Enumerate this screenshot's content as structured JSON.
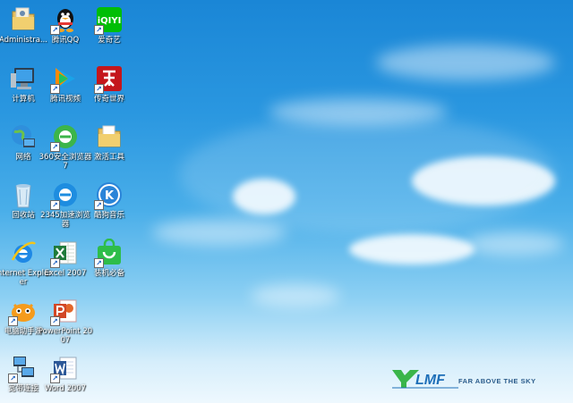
{
  "desktop": {
    "icons": [
      {
        "label": "Administra...",
        "icon": "folder-user-icon"
      },
      {
        "label": "腾讯QQ",
        "icon": "qq-penguin-icon"
      },
      {
        "label": "爱奇艺",
        "icon": "iqiyi-icon"
      },
      {
        "label": "计算机",
        "icon": "computer-icon"
      },
      {
        "label": "腾讯视频",
        "icon": "tencent-video-icon"
      },
      {
        "label": "传奇世界",
        "icon": "legend-world-icon"
      },
      {
        "label": "网络",
        "icon": "network-icon"
      },
      {
        "label": "360安全浏览器7",
        "icon": "360-browser-icon"
      },
      {
        "label": "激活工具",
        "icon": "folder-icon"
      },
      {
        "label": "回收站",
        "icon": "recycle-bin-icon"
      },
      {
        "label": "2345加速浏览器",
        "icon": "2345-browser-icon"
      },
      {
        "label": "酷狗音乐",
        "icon": "kugou-music-icon"
      },
      {
        "label": "Internet Explorer",
        "icon": "ie-icon"
      },
      {
        "label": "Excel 2007",
        "icon": "excel-icon"
      },
      {
        "label": "装机必备",
        "icon": "shopping-bag-icon"
      },
      {
        "label": "电脑助手游",
        "icon": "game-icon"
      },
      {
        "label": "PowerPoint 2007",
        "icon": "powerpoint-icon"
      },
      {
        "label": "宽带连接",
        "icon": "broadband-icon"
      },
      {
        "label": "Word 2007",
        "icon": "word-icon"
      }
    ]
  },
  "wallpaper": {
    "logo_text": "FAR ABOVE THE SKY",
    "logo_mark": "YLMF",
    "colors": {
      "sky_top": "#1a86d6",
      "sky_bottom": "#eef8fe",
      "logo_green": "#3ab54a",
      "logo_blue": "#1e6fb8"
    }
  }
}
